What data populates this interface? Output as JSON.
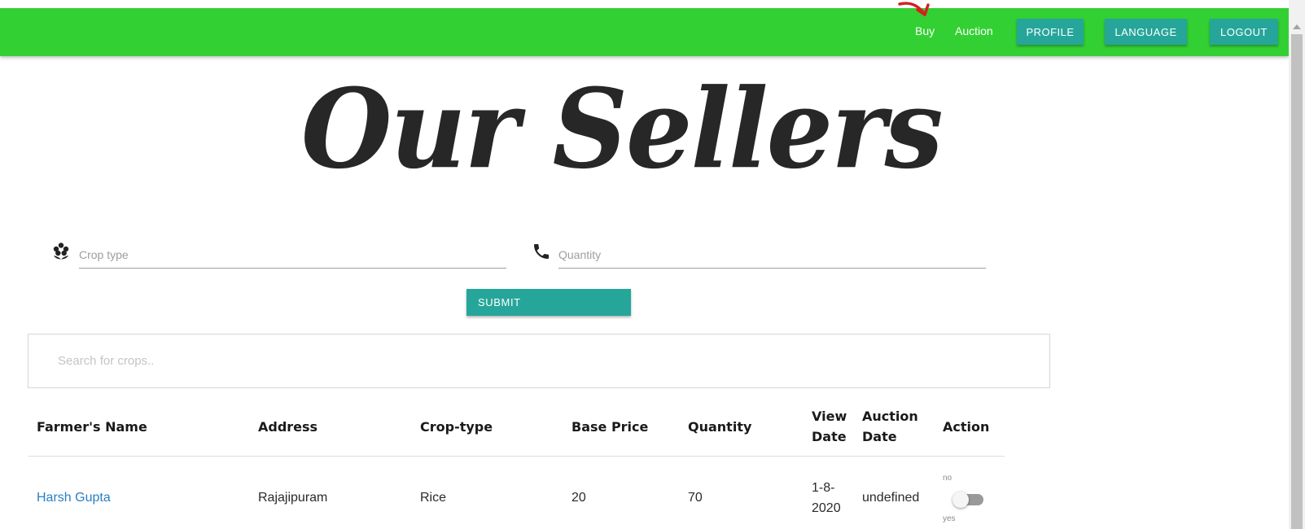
{
  "navbar": {
    "color": "#33d033",
    "links": [
      "Buy",
      "Auction"
    ],
    "buttons": [
      "PROFILE",
      "LANGUAGE",
      "LOGOUT"
    ],
    "button_color": "#26a69a"
  },
  "page": {
    "title": "Our Sellers"
  },
  "form": {
    "crop_type": {
      "placeholder": "Crop type",
      "value": "",
      "icon": "flower-icon"
    },
    "quantity": {
      "placeholder": "Quantity",
      "value": "",
      "icon": "phone-icon"
    },
    "submit_label": "SUBMIT"
  },
  "search": {
    "placeholder": "Search for crops..",
    "value": ""
  },
  "table": {
    "headers": {
      "farmer": "Farmer's Name",
      "address": "Address",
      "crop": "Crop-type",
      "price": "Base Price",
      "quantity": "Quantity",
      "view_date": [
        "View",
        "Date"
      ],
      "auction_date": [
        "Auction",
        "Date"
      ],
      "action": "Action"
    },
    "rows": [
      {
        "farmer": "Harsh Gupta",
        "address": "Rajajipuram",
        "crop": "Rice",
        "price": "20",
        "quantity": "70",
        "view_date": [
          "1-8-",
          "2020"
        ],
        "auction_date": "undefined",
        "toggle_off_label": "no",
        "toggle_on_label": "yes",
        "toggle_on": false
      }
    ]
  }
}
